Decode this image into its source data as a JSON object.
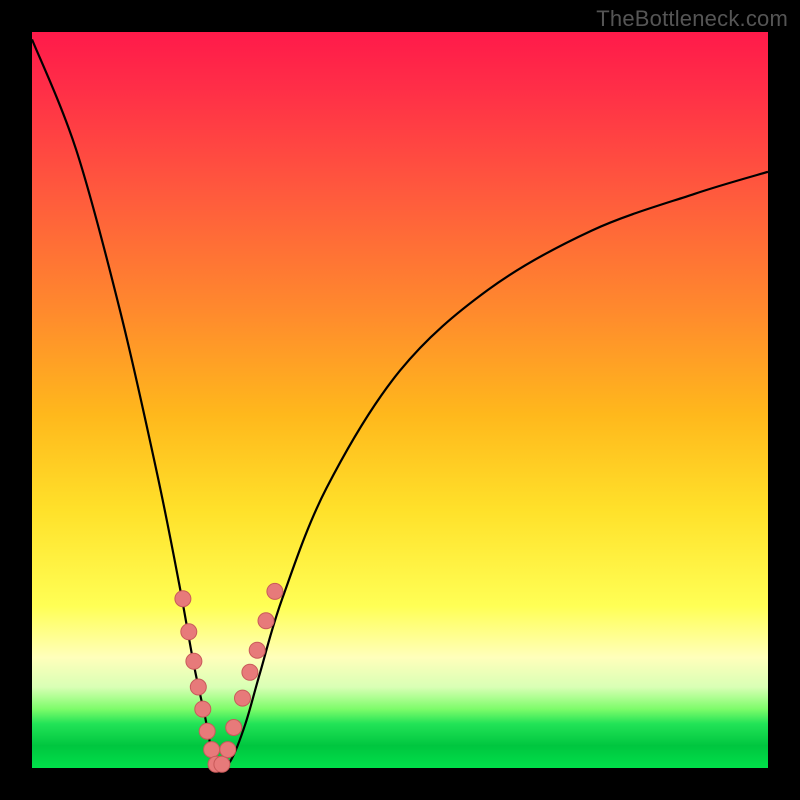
{
  "watermark": "TheBottleneck.com",
  "chart_data": {
    "type": "line",
    "title": "",
    "xlabel": "",
    "ylabel": "",
    "xlim": [
      0,
      100
    ],
    "ylim": [
      0,
      100
    ],
    "series": [
      {
        "name": "bottleneck-curve",
        "x": [
          0,
          6,
          12,
          17,
          20,
          22,
          23.5,
          24.5,
          25.5,
          27,
          29,
          31,
          34,
          40,
          50,
          62,
          76,
          90,
          100
        ],
        "y": [
          99,
          84,
          62,
          40,
          25,
          14,
          7,
          2,
          0,
          1,
          6,
          13,
          23,
          38,
          54,
          65,
          73,
          78,
          81
        ]
      }
    ],
    "markers": {
      "name": "highlight-dots",
      "x": [
        20.5,
        21.3,
        22.0,
        22.6,
        23.2,
        23.8,
        24.4,
        25.0,
        25.8,
        26.6,
        27.4,
        28.6,
        29.6,
        30.6,
        31.8,
        33.0
      ],
      "y": [
        23,
        18.5,
        14.5,
        11,
        8,
        5,
        2.5,
        0.5,
        0.5,
        2.5,
        5.5,
        9.5,
        13,
        16,
        20,
        24
      ]
    },
    "gradient_stops": [
      {
        "pos": 0,
        "color": "#ff1a4a"
      },
      {
        "pos": 22,
        "color": "#ff5a3d"
      },
      {
        "pos": 52,
        "color": "#ffb81c"
      },
      {
        "pos": 78,
        "color": "#ffff55"
      },
      {
        "pos": 92,
        "color": "#7dfc6a"
      },
      {
        "pos": 100,
        "color": "#00e04a"
      }
    ]
  }
}
